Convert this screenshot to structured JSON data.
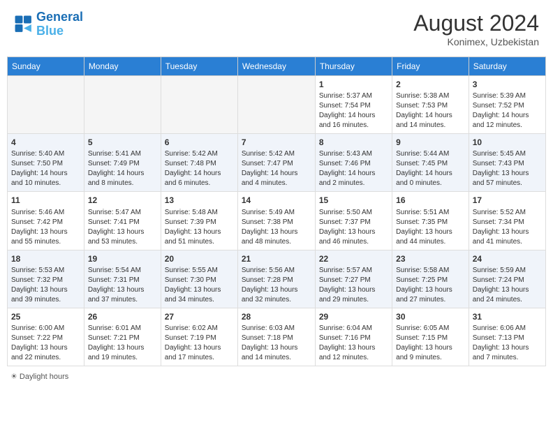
{
  "header": {
    "logo_line1": "General",
    "logo_line2": "Blue",
    "month_year": "August 2024",
    "location": "Konimex, Uzbekistan"
  },
  "days_of_week": [
    "Sunday",
    "Monday",
    "Tuesday",
    "Wednesday",
    "Thursday",
    "Friday",
    "Saturday"
  ],
  "weeks": [
    [
      {
        "day": "",
        "info": ""
      },
      {
        "day": "",
        "info": ""
      },
      {
        "day": "",
        "info": ""
      },
      {
        "day": "",
        "info": ""
      },
      {
        "day": "1",
        "info": "Sunrise: 5:37 AM\nSunset: 7:54 PM\nDaylight: 14 hours\nand 16 minutes."
      },
      {
        "day": "2",
        "info": "Sunrise: 5:38 AM\nSunset: 7:53 PM\nDaylight: 14 hours\nand 14 minutes."
      },
      {
        "day": "3",
        "info": "Sunrise: 5:39 AM\nSunset: 7:52 PM\nDaylight: 14 hours\nand 12 minutes."
      }
    ],
    [
      {
        "day": "4",
        "info": "Sunrise: 5:40 AM\nSunset: 7:50 PM\nDaylight: 14 hours\nand 10 minutes."
      },
      {
        "day": "5",
        "info": "Sunrise: 5:41 AM\nSunset: 7:49 PM\nDaylight: 14 hours\nand 8 minutes."
      },
      {
        "day": "6",
        "info": "Sunrise: 5:42 AM\nSunset: 7:48 PM\nDaylight: 14 hours\nand 6 minutes."
      },
      {
        "day": "7",
        "info": "Sunrise: 5:42 AM\nSunset: 7:47 PM\nDaylight: 14 hours\nand 4 minutes."
      },
      {
        "day": "8",
        "info": "Sunrise: 5:43 AM\nSunset: 7:46 PM\nDaylight: 14 hours\nand 2 minutes."
      },
      {
        "day": "9",
        "info": "Sunrise: 5:44 AM\nSunset: 7:45 PM\nDaylight: 14 hours\nand 0 minutes."
      },
      {
        "day": "10",
        "info": "Sunrise: 5:45 AM\nSunset: 7:43 PM\nDaylight: 13 hours\nand 57 minutes."
      }
    ],
    [
      {
        "day": "11",
        "info": "Sunrise: 5:46 AM\nSunset: 7:42 PM\nDaylight: 13 hours\nand 55 minutes."
      },
      {
        "day": "12",
        "info": "Sunrise: 5:47 AM\nSunset: 7:41 PM\nDaylight: 13 hours\nand 53 minutes."
      },
      {
        "day": "13",
        "info": "Sunrise: 5:48 AM\nSunset: 7:39 PM\nDaylight: 13 hours\nand 51 minutes."
      },
      {
        "day": "14",
        "info": "Sunrise: 5:49 AM\nSunset: 7:38 PM\nDaylight: 13 hours\nand 48 minutes."
      },
      {
        "day": "15",
        "info": "Sunrise: 5:50 AM\nSunset: 7:37 PM\nDaylight: 13 hours\nand 46 minutes."
      },
      {
        "day": "16",
        "info": "Sunrise: 5:51 AM\nSunset: 7:35 PM\nDaylight: 13 hours\nand 44 minutes."
      },
      {
        "day": "17",
        "info": "Sunrise: 5:52 AM\nSunset: 7:34 PM\nDaylight: 13 hours\nand 41 minutes."
      }
    ],
    [
      {
        "day": "18",
        "info": "Sunrise: 5:53 AM\nSunset: 7:32 PM\nDaylight: 13 hours\nand 39 minutes."
      },
      {
        "day": "19",
        "info": "Sunrise: 5:54 AM\nSunset: 7:31 PM\nDaylight: 13 hours\nand 37 minutes."
      },
      {
        "day": "20",
        "info": "Sunrise: 5:55 AM\nSunset: 7:30 PM\nDaylight: 13 hours\nand 34 minutes."
      },
      {
        "day": "21",
        "info": "Sunrise: 5:56 AM\nSunset: 7:28 PM\nDaylight: 13 hours\nand 32 minutes."
      },
      {
        "day": "22",
        "info": "Sunrise: 5:57 AM\nSunset: 7:27 PM\nDaylight: 13 hours\nand 29 minutes."
      },
      {
        "day": "23",
        "info": "Sunrise: 5:58 AM\nSunset: 7:25 PM\nDaylight: 13 hours\nand 27 minutes."
      },
      {
        "day": "24",
        "info": "Sunrise: 5:59 AM\nSunset: 7:24 PM\nDaylight: 13 hours\nand 24 minutes."
      }
    ],
    [
      {
        "day": "25",
        "info": "Sunrise: 6:00 AM\nSunset: 7:22 PM\nDaylight: 13 hours\nand 22 minutes."
      },
      {
        "day": "26",
        "info": "Sunrise: 6:01 AM\nSunset: 7:21 PM\nDaylight: 13 hours\nand 19 minutes."
      },
      {
        "day": "27",
        "info": "Sunrise: 6:02 AM\nSunset: 7:19 PM\nDaylight: 13 hours\nand 17 minutes."
      },
      {
        "day": "28",
        "info": "Sunrise: 6:03 AM\nSunset: 7:18 PM\nDaylight: 13 hours\nand 14 minutes."
      },
      {
        "day": "29",
        "info": "Sunrise: 6:04 AM\nSunset: 7:16 PM\nDaylight: 13 hours\nand 12 minutes."
      },
      {
        "day": "30",
        "info": "Sunrise: 6:05 AM\nSunset: 7:15 PM\nDaylight: 13 hours\nand 9 minutes."
      },
      {
        "day": "31",
        "info": "Sunrise: 6:06 AM\nSunset: 7:13 PM\nDaylight: 13 hours\nand 7 minutes."
      }
    ]
  ],
  "legend": {
    "daylight_hours": "Daylight hours"
  }
}
